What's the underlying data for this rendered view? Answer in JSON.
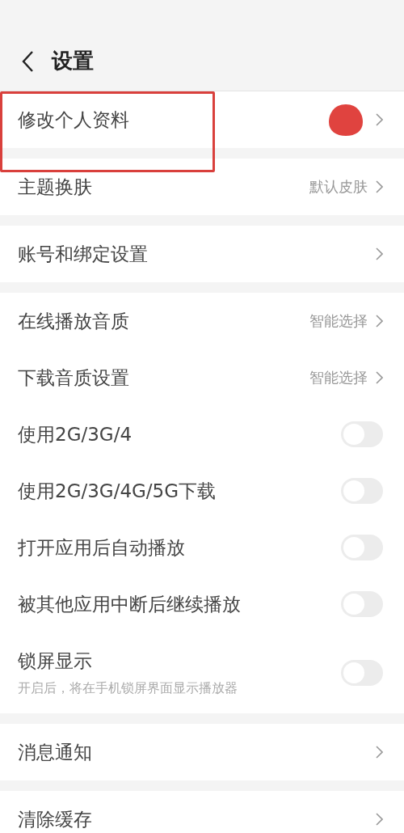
{
  "header": {
    "title": "设置"
  },
  "highlight": {
    "kind": "box",
    "color": "#d9403c"
  },
  "groups": [
    {
      "items": [
        {
          "kind": "link",
          "label": "修改个人资料",
          "avatar": true
        }
      ]
    },
    {
      "items": [
        {
          "kind": "link",
          "label": "主题换肤",
          "value": "默认皮肤"
        }
      ]
    },
    {
      "items": [
        {
          "kind": "link",
          "label": "账号和绑定设置"
        }
      ]
    },
    {
      "items": [
        {
          "kind": "link",
          "label": "在线播放音质",
          "value": "智能选择"
        },
        {
          "kind": "link",
          "label": "下载音质设置",
          "value": "智能选择"
        },
        {
          "kind": "toggle",
          "label": "使用2G/3G/4",
          "on": false
        },
        {
          "kind": "toggle",
          "label": "使用2G/3G/4G/5G下载",
          "on": false
        },
        {
          "kind": "toggle",
          "label": "打开应用后自动播放",
          "on": false
        },
        {
          "kind": "toggle",
          "label": "被其他应用中断后继续播放",
          "on": false
        },
        {
          "kind": "toggle",
          "label": "锁屏显示",
          "subtitle": "开启后，将在手机锁屏界面显示播放器",
          "on": false
        }
      ]
    },
    {
      "items": [
        {
          "kind": "link",
          "label": "消息通知"
        }
      ]
    },
    {
      "items": [
        {
          "kind": "link",
          "label": "清除缓存"
        }
      ]
    }
  ]
}
